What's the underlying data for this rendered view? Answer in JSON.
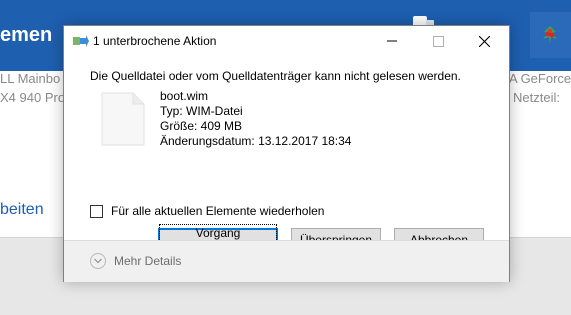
{
  "background": {
    "header_fragment": "emen",
    "line1_left": "LL Mainbo",
    "line2_left": "X4 940 Pro",
    "line1_right": "A GeForce",
    "line2_right": "Netzteil:",
    "link_fragment": "beiten"
  },
  "dialog": {
    "title": "1 unterbrochene Aktion",
    "message": "Die Quelldatei oder vom Quelldatenträger kann nicht gelesen werden.",
    "file": {
      "name": "boot.wim",
      "type": "Typ: WIM-Datei",
      "size": "Größe: 409 MB",
      "modified": "Änderungsdatum: 13.12.2017 18:34"
    },
    "repeat_checkbox_label": "Für alle aktuellen Elemente wiederholen",
    "buttons": {
      "retry": "Vorgang wiederholen",
      "skip": "Überspringen",
      "cancel": "Abbrechen"
    },
    "more_details": "Mehr Details"
  }
}
